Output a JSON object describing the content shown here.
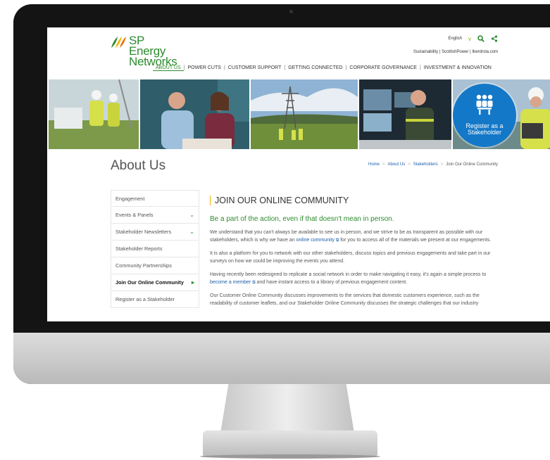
{
  "header": {
    "logo_line1": "SP Energy",
    "logo_line2": "Networks",
    "language": "English",
    "language_chevron": "v",
    "util_links": "Sustainability | ScottishPower | Iberdrola.com",
    "icons": [
      "search-icon",
      "share-icon"
    ]
  },
  "nav": {
    "items": [
      "ABOUT US",
      "POWER CUTS",
      "CUSTOMER SUPPORT",
      "GETTING CONNECTED",
      "CORPORATE GOVERNANCE",
      "INVESTMENT & INNOVATION"
    ],
    "separator": "|"
  },
  "banner": {
    "register_line1": "Register as a",
    "register_line2": "Stakeholder"
  },
  "page": {
    "title": "About Us",
    "breadcrumb": [
      "Home",
      "About Us",
      "Stakeholders",
      "Join Our Online Community"
    ],
    "breadcrumb_sep": ">"
  },
  "sidebar": {
    "items": [
      {
        "label": "Engagement",
        "arrow": ""
      },
      {
        "label": "Events & Panels",
        "arrow": "⌄"
      },
      {
        "label": "Stakeholder Newsletters",
        "arrow": "⌄"
      },
      {
        "label": "Stakeholder Reports",
        "arrow": ""
      },
      {
        "label": "Community Partnerships",
        "arrow": ""
      },
      {
        "label": "Join Our Online Community",
        "arrow": "▸"
      },
      {
        "label": "Register as a Stakeholder",
        "arrow": ""
      }
    ]
  },
  "content": {
    "heading": "JOIN OUR ONLINE COMMUNITY",
    "subheading": "Be a part of the action, even if that doesn't mean in person.",
    "p1_before": "We understand that you can't always be available to see us in person, and we strive to be as transparent as possible with our stakeholders, which is why we have an ",
    "p1_link": "online community",
    "p1_after": " for you to access all of the materials we present at our engagements.",
    "p2": "It is also a platform for you to network with our other stakeholders, discuss topics and previous engagements and take part in our surveys on how we could be improving the events you attend.",
    "p3_before": "Having recently been redesigned to replicate a social network in order to make navigating it easy, it's again a simple process to ",
    "p3_link": "become a member",
    "p3_after": " and have instant access to a library of previous engagement content.",
    "p4": "Our Customer Online Community discusses improvements to the services that domestic customers experience, such as the readability of customer leaflets, and our Stakeholder Online Community discusses the strategic challenges that our industry",
    "external_glyph": "⧉"
  },
  "colors": {
    "brand_green": "#2e8b2f",
    "link_blue": "#1a5fa8",
    "register_blue": "#1478c8",
    "accent_yellow": "#f0b400"
  }
}
